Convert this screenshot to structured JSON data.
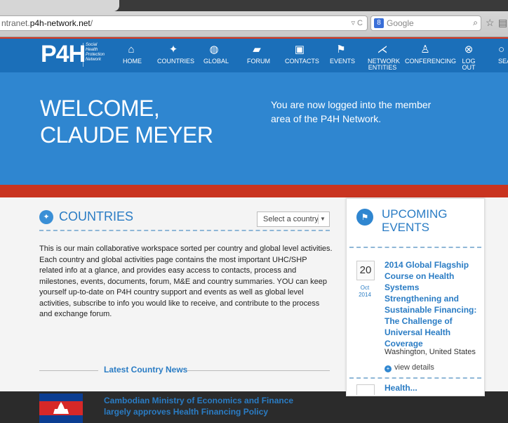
{
  "browser": {
    "url_prefix": "ntranet.",
    "url_domain": "p4h-network.net",
    "url_suffix": "/",
    "search_engine": "Google",
    "search_badge": "8"
  },
  "logo": {
    "mark": "P4H",
    "tagline_lines": [
      "Social",
      "Health",
      "Protection",
      "Network"
    ]
  },
  "nav": [
    {
      "label": "HOME",
      "icon": "home-icon",
      "glyph": "⌂"
    },
    {
      "label": "COUNTRIES",
      "icon": "map-icon",
      "glyph": "✦"
    },
    {
      "label": "GLOBAL",
      "icon": "globe-icon",
      "glyph": "◍"
    },
    {
      "label": "FORUM",
      "icon": "chat-icon",
      "glyph": "▰"
    },
    {
      "label": "CONTACTS",
      "icon": "contact-card-icon",
      "glyph": "▣"
    },
    {
      "label": "EVENTS",
      "icon": "flag-icon",
      "glyph": "⚑"
    },
    {
      "label": "NETWORK",
      "label2": "ENTITIES",
      "icon": "network-icon",
      "glyph": "⋌"
    },
    {
      "label": "CONFERENCING",
      "icon": "presenter-icon",
      "glyph": "♙"
    },
    {
      "label": "LOG OUT",
      "icon": "logout-icon",
      "glyph": "⊗"
    },
    {
      "label": "SEA",
      "icon": "search-icon",
      "glyph": "○"
    }
  ],
  "hero": {
    "welcome_line1": "WELCOME,",
    "welcome_line2": "CLAUDE MEYER",
    "message": "You are now logged into the member area of the P4H Network."
  },
  "countries": {
    "title": "COUNTRIES",
    "select_placeholder": "Select a country",
    "intro": "This is our main collaborative workspace sorted per country and global level activities. Each country and global activities page contains the most important UHC/SHP related info at a glance, and provides easy access to contacts, process and milestones, events, documents, forum, M&E and country summaries. YOU can keep yourself up-to-date on P4H country support and events as well as global level activities, subscribe to info you would like to receive, and contribute to the process and exchange forum.",
    "news_heading": "Latest Country News",
    "news": [
      {
        "title": "Cambodian Ministry of Economics and Finance largely approves Health Financing Policy"
      }
    ]
  },
  "events": {
    "title": "UPCOMING EVENTS",
    "items": [
      {
        "day": "20",
        "month": "Oct",
        "year": "2014",
        "title": "2014 Global Flagship Course on Health Systems Strengthening and Sustainable Financing: The Challenge of Universal Health Coverage",
        "location": "Washington, United States",
        "link": "view details"
      }
    ],
    "next_title": "Health..."
  },
  "colors": {
    "nav_blue": "#1b6fb9",
    "hero_blue": "#2f86d0",
    "accent_red": "#c93420",
    "link_blue": "#2a7cc4"
  }
}
